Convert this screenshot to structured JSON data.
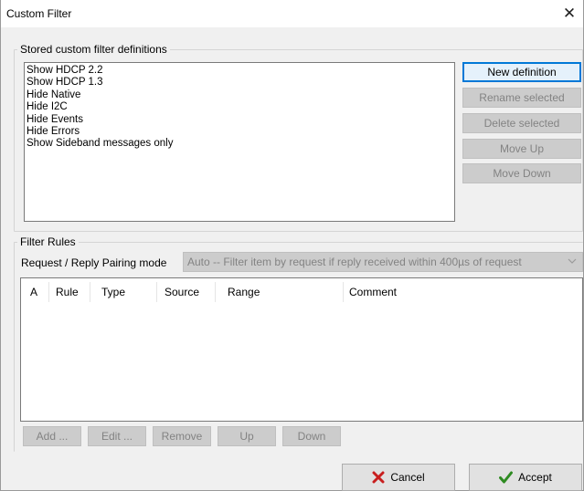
{
  "window": {
    "title": "Custom Filter",
    "close_glyph": "✕"
  },
  "stored": {
    "group_label": "Stored custom filter definitions",
    "items": [
      "Show HDCP 2.2",
      "Show HDCP 1.3",
      "Hide Native",
      "Hide I2C",
      "Hide Events",
      "Hide Errors",
      "Show Sideband messages only"
    ],
    "buttons": {
      "new": "New definition",
      "rename": "Rename selected",
      "delete": "Delete selected",
      "move_up": "Move Up",
      "move_down": "Move Down"
    }
  },
  "rules": {
    "group_label": "Filter Rules",
    "pairing_label": "Request / Reply Pairing mode",
    "pairing_value": "Auto -- Filter item by request if reply received within 400µs of request",
    "columns": [
      "A",
      "Rule",
      "Type",
      "Source",
      "Range",
      "Comment"
    ],
    "buttons": {
      "add": "Add ...",
      "edit": "Edit ...",
      "remove": "Remove",
      "up": "Up",
      "down": "Down"
    }
  },
  "footer": {
    "cancel": "Cancel",
    "accept": "Accept",
    "cancel_icon": "red-x-icon",
    "accept_icon": "green-check-icon"
  },
  "colors": {
    "cancel_icon": "#c81e1e",
    "accept_icon": "#2e8b21",
    "default_border": "#0078d7"
  }
}
